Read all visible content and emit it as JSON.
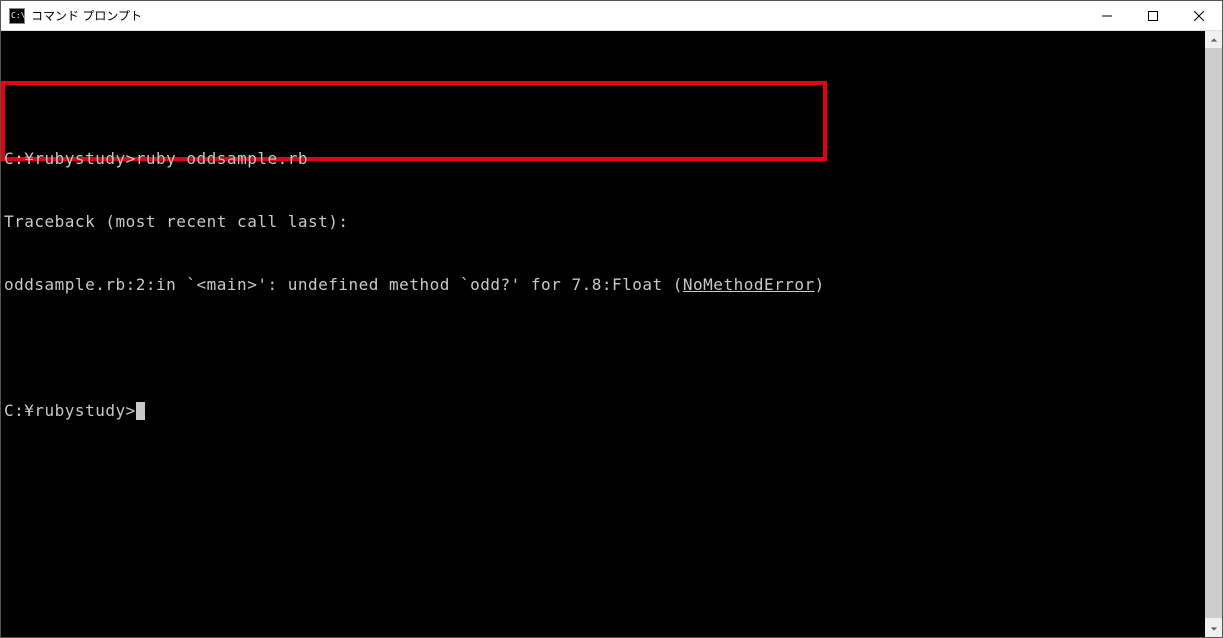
{
  "window": {
    "title": "コマンド プロンプト"
  },
  "terminal": {
    "line1_prompt": "C:¥rubystudy>",
    "line1_cmd": "ruby oddsample.rb",
    "line2": "Traceback (most recent call last):",
    "line3_a": "oddsample.rb:2:in `<main>': undefined method `odd?' for 7.8:Float (",
    "line3_err": "NoMethodError",
    "line3_b": ")",
    "line5_prompt": "C:¥rubystudy>"
  }
}
